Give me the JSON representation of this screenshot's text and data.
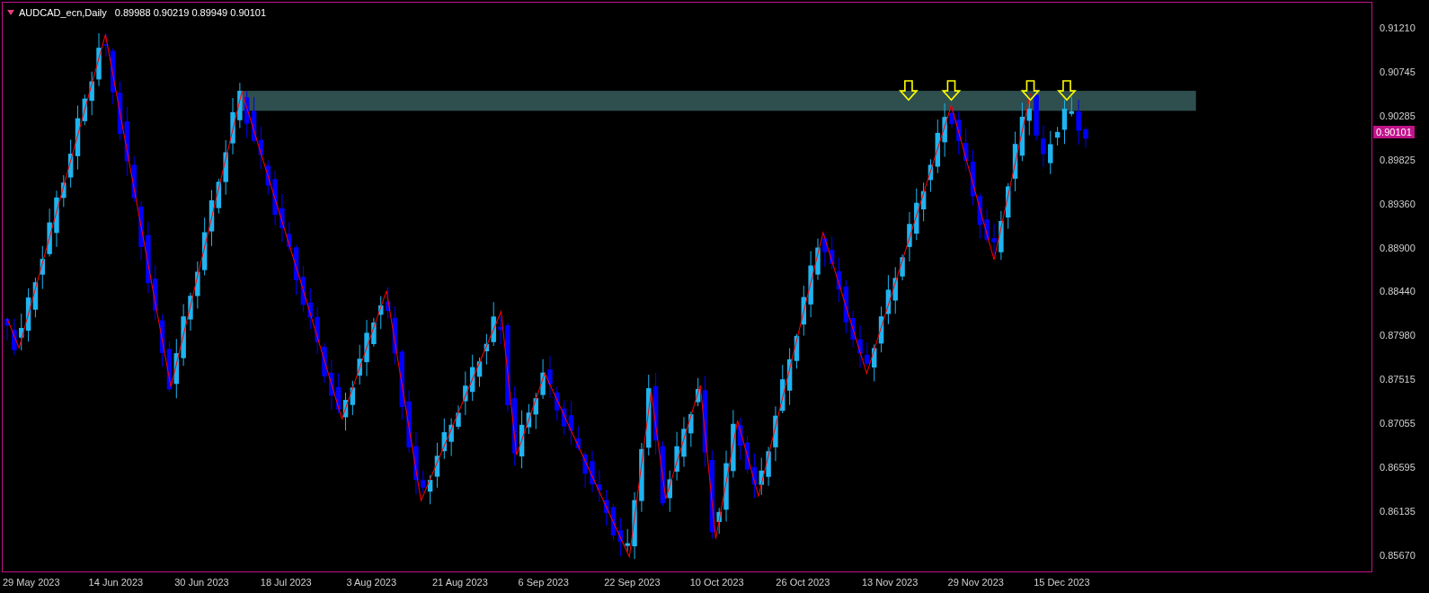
{
  "header": {
    "symbol": "AUDCAD_ecn,Daily",
    "ohlc": "0.89988 0.90219 0.89949 0.90101"
  },
  "price_axis": [
    "0.91210",
    "0.90745",
    "0.90285",
    "0.89825",
    "0.89360",
    "0.88900",
    "0.88440",
    "0.87980",
    "0.87515",
    "0.87055",
    "0.86595",
    "0.86135",
    "0.85670"
  ],
  "current_price": "0.90101",
  "date_axis": [
    "29 May 2023",
    "14 Jun 2023",
    "30 Jun 2023",
    "18 Jul 2023",
    "3 Aug 2023",
    "21 Aug 2023",
    "6 Sep 2023",
    "22 Sep 2023",
    "10 Oct 2023",
    "26 Oct 2023",
    "13 Nov 2023",
    "29 Nov 2023",
    "15 Dec 2023"
  ]
}
